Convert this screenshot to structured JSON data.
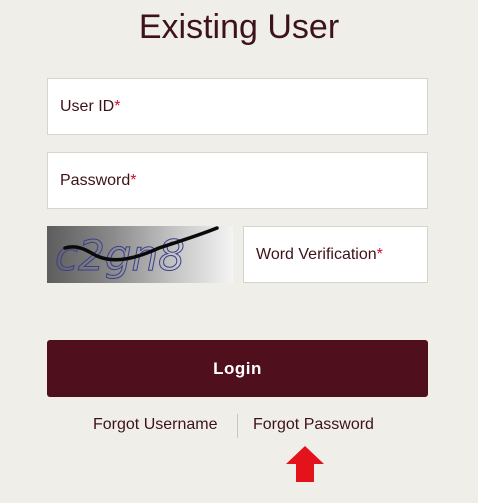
{
  "title": "Existing User",
  "form": {
    "user_id": {
      "label": "User ID",
      "required_mark": "*",
      "value": ""
    },
    "password": {
      "label": "Password",
      "required_mark": "*",
      "value": ""
    },
    "captcha": {
      "text": "c2gn8"
    },
    "word_verification": {
      "label": "Word Verification",
      "required_mark": "*",
      "value": ""
    }
  },
  "login_label": "Login",
  "links": {
    "forgot_username": "Forgot Username",
    "forgot_password": "Forgot Password"
  },
  "colors": {
    "background": "#efeee9",
    "primary": "#4f0f1d",
    "text": "#3d1218",
    "required": "#c8102e",
    "arrow": "#e4121b"
  },
  "icons": {
    "arrow": "arrow-up-icon"
  }
}
